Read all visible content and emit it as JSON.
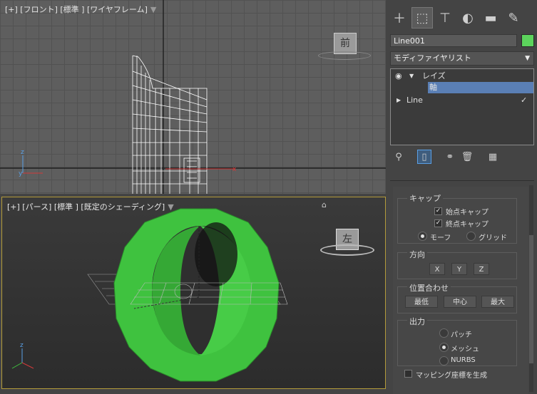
{
  "viewports": {
    "front": {
      "label": "[+] [フロント] [標準 ] [ワイヤフレーム]",
      "viewcube_label": "前"
    },
    "perspective": {
      "label": "[+] [パース] [標準 ] [既定のシェーディング]",
      "viewcube_label": "左"
    }
  },
  "panel": {
    "tabs": [
      "create-icon",
      "modify-icon",
      "hierarchy-icon",
      "motion-icon",
      "display-icon",
      "utilities-icon"
    ],
    "object_name": "Line001",
    "object_color": "#5cd35c",
    "modifier_list": "モディファイヤリスト",
    "stack": {
      "lathe": "レイズ",
      "axis": "軸",
      "line": "Line"
    },
    "rollout": {
      "capping_title": "キャップ",
      "cap_start": "始点キャップ",
      "cap_end": "終点キャップ",
      "morph": "モーフ",
      "grid": "グリッド",
      "direction_title": "方向",
      "x": "X",
      "y": "Y",
      "z": "Z",
      "align_title": "位置合わせ",
      "min": "最低",
      "center": "中心",
      "max": "最大",
      "output_title": "出力",
      "patch": "パッチ",
      "mesh": "メッシュ",
      "nurbs": "NURBS",
      "gen_map": "マッピング座標を生成"
    }
  }
}
